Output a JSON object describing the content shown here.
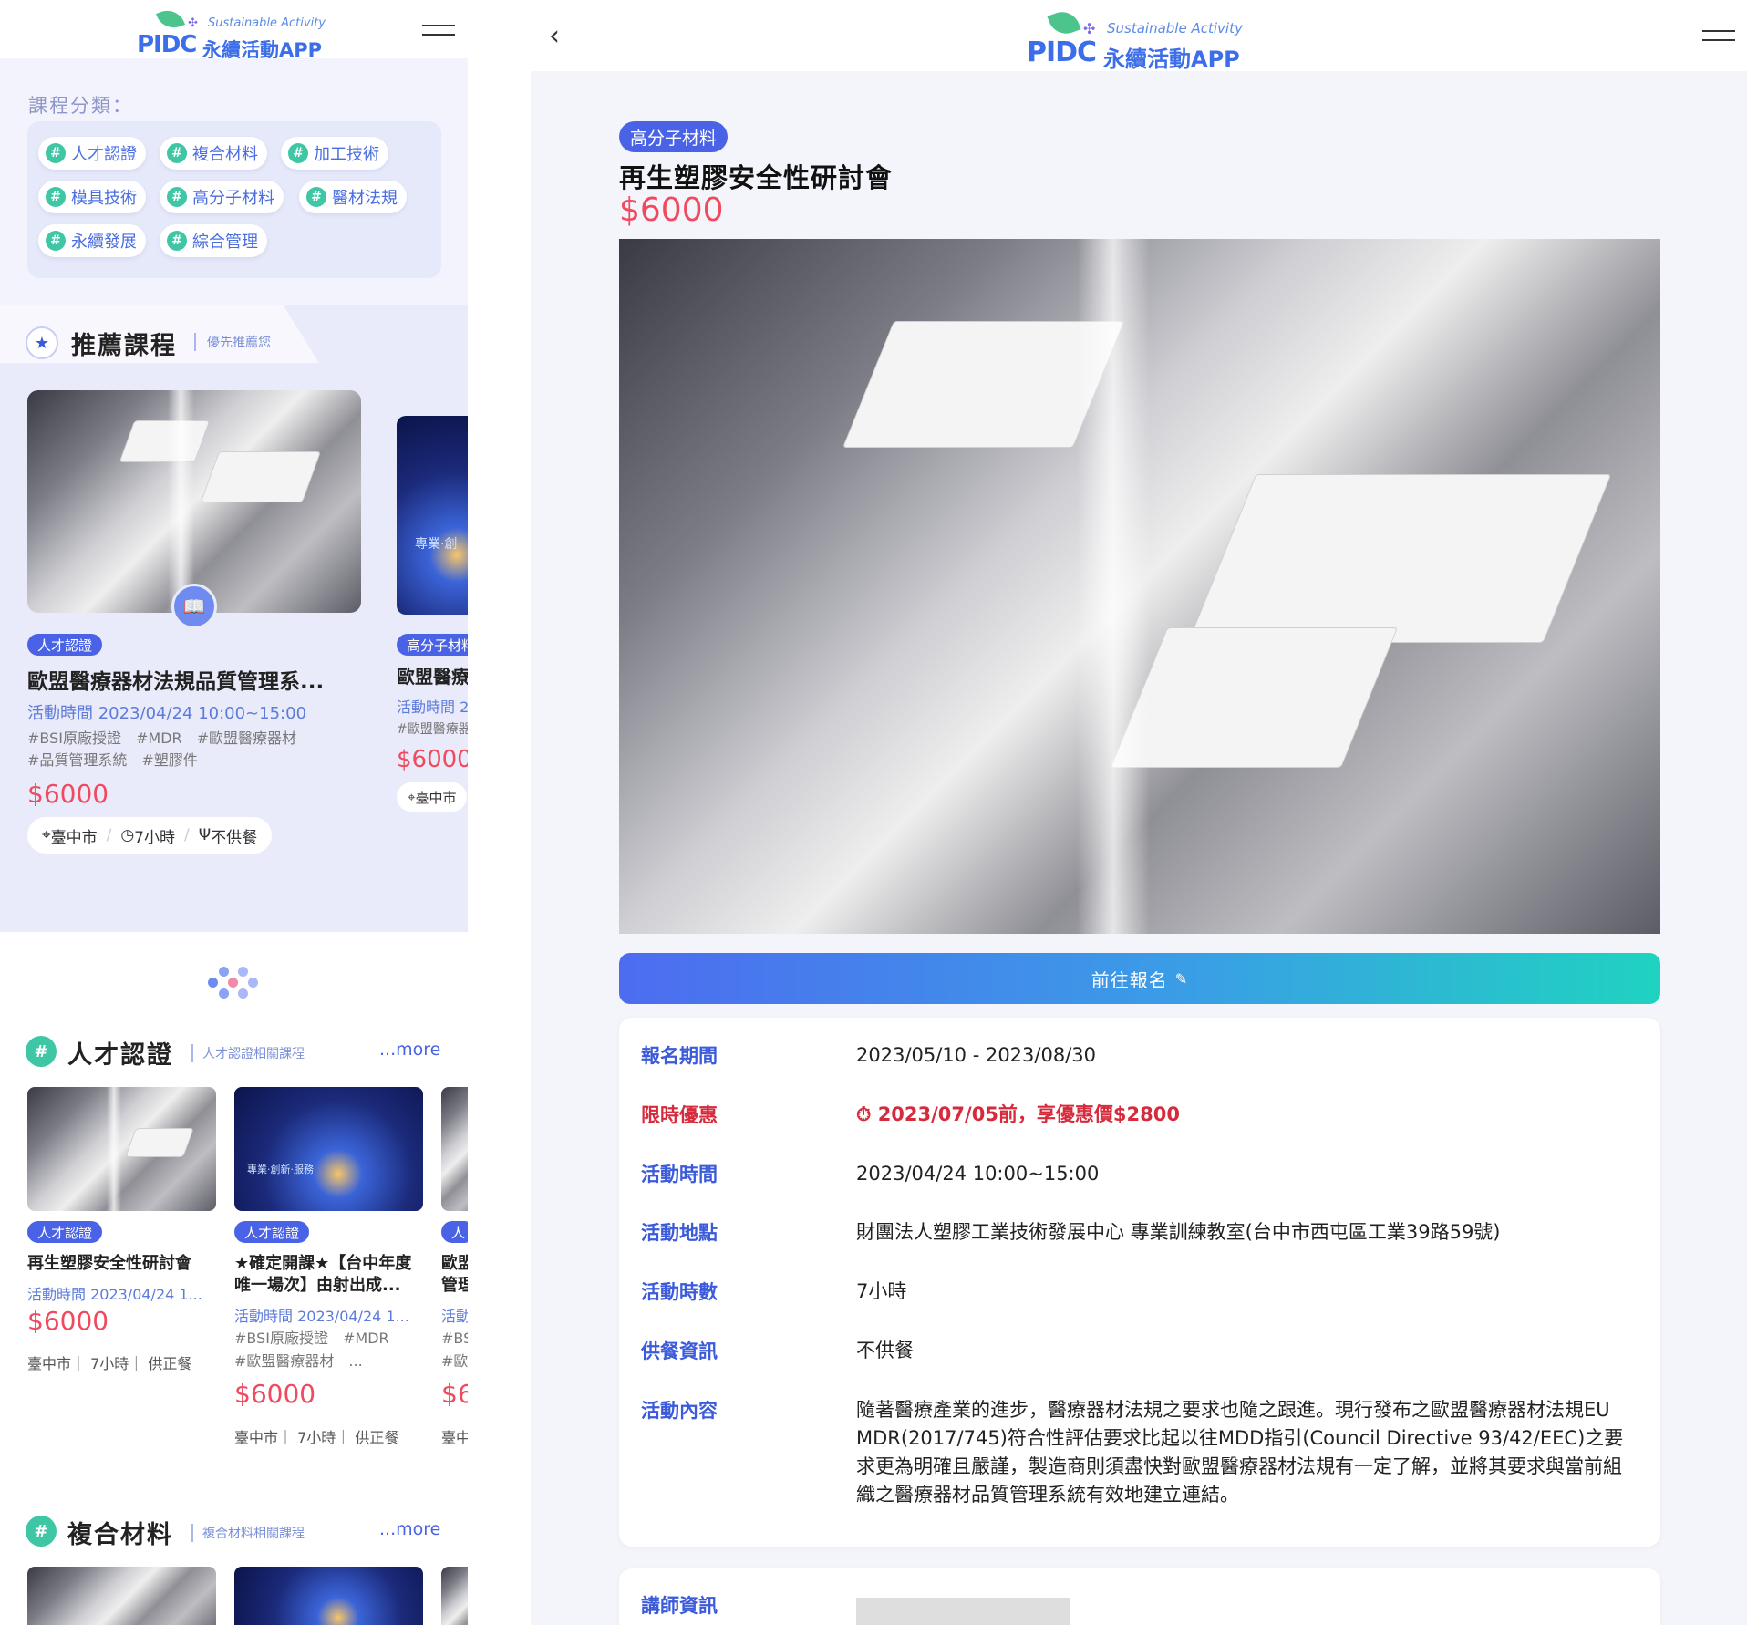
{
  "left": {
    "logo": {
      "sustainable": "Sustainable Activity",
      "mark": "PIDC",
      "app": "永續活動APP"
    },
    "categories_title": "課程分類：",
    "categories": [
      "人才認證",
      "複合材料",
      "加工技術",
      "模具技術",
      "高分子材料",
      "醫材法規",
      "永續發展",
      "綜合管理"
    ],
    "recommended": {
      "title": "推薦課程",
      "subtitle": "優先推薦您",
      "card1": {
        "badge": "人才認證",
        "title": "歐盟醫療器材法規品質管理系...",
        "time": "活動時間 2023/04/24 10:00~15:00",
        "tags1": "#BSI原廠授證　#MDR　#歐盟醫療器材",
        "tags2": "#品質管理系統　#塑膠件",
        "price": "$6000",
        "location": "臺中市",
        "hours": "7小時",
        "meal": "不供餐"
      },
      "card2": {
        "badge": "高分子材料",
        "title": "歐盟醫療",
        "time": "活動時間 2",
        "tags": "#歐盟醫療器",
        "price": "$6000",
        "location": "臺中市",
        "img_text": "專業·創"
      }
    },
    "section1": {
      "title": "人才認證",
      "subtitle": "人才認證相關課程",
      "more": "...more",
      "items": [
        {
          "badge": "人才認證",
          "title": "再生塑膠安全性研討會",
          "title2": "",
          "time": "活動時間 2023/04/24 1...",
          "tags1": "",
          "tags2": "",
          "price": "$6000",
          "info": "臺中市｜ 7小時｜ 供正餐"
        },
        {
          "badge": "人才認證",
          "title": "★確定開課★【台中年度",
          "title2": "唯一場次】由射出成...",
          "time": "活動時間 2023/04/24 1...",
          "tags1": "#BSI原廠授證　#MDR",
          "tags2": "#歐盟醫療器材　...",
          "price": "$6000",
          "info": "臺中市｜ 7小時｜ 供正餐",
          "img_text": "專業·創新·服務"
        },
        {
          "badge": "人",
          "title": "歐盟",
          "title2": "管理",
          "time": "活動",
          "tags1": "#BS",
          "tags2": "#歐",
          "price": "$6",
          "info": "臺中"
        }
      ]
    },
    "section2": {
      "title": "複合材料",
      "subtitle": "複合材料相關課程",
      "more": "...more"
    }
  },
  "right": {
    "logo": {
      "sustainable": "Sustainable Activity",
      "mark": "PIDC",
      "app": "永續活動APP"
    },
    "back_icon": "chevron-left-icon",
    "badge": "高分子材料",
    "title": "再生塑膠安全性研討會",
    "price": "$6000",
    "register_button": "前往報名",
    "details": [
      {
        "label": "報名期間",
        "value": "2023/05/10 - 2023/08/30"
      },
      {
        "label": "限時優惠",
        "value": "⏱ 2023/07/05前，享優惠價$2800"
      },
      {
        "label": "活動時間",
        "value": "2023/04/24 10:00~15:00"
      },
      {
        "label": "活動地點",
        "value": "財團法人塑膠工業技術發展中心 專業訓練教室(台中市西屯區工業39路59號)"
      },
      {
        "label": "活動時數",
        "value": "7小時"
      },
      {
        "label": "供餐資訊",
        "value": "不供餐"
      },
      {
        "label": "活動內容",
        "value": "隨著醫療產業的進步，醫療器材法規之要求也隨之跟進。現行發布之歐盟醫療器材法規EU MDR(2017/745)符合性評估要求比起以往MDD指引(Council Directive 93/42/EEC)之要求更為明確且嚴謹，製造商則須盡快對歐盟醫療器材法規有一定了解，並將其要求與當前組織之醫療器材品質管理系統有效地建立連結。"
      }
    ],
    "instructor_label": "講師資訊"
  },
  "colors": {
    "accent": "#4a63e6",
    "price": "#ef4a5f",
    "teal": "#3fc7a5",
    "promo": "#d62b3c"
  }
}
